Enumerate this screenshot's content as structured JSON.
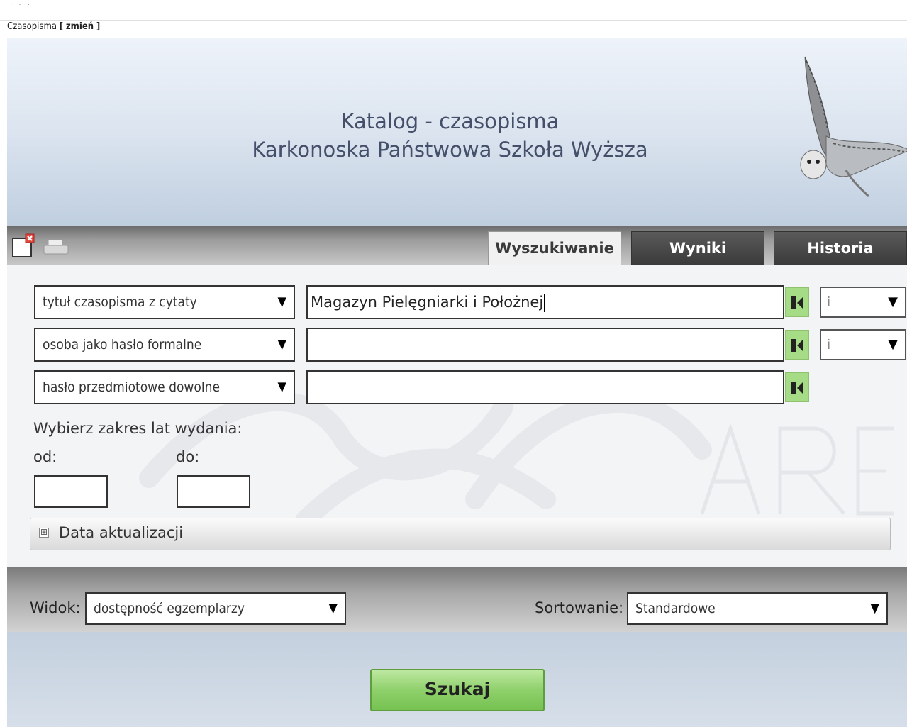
{
  "breadcrumb": {
    "label": "Czasopisma",
    "open": "[",
    "link": "zmień",
    "close": "]"
  },
  "header": {
    "title_line1": "Katalog - czasopisma",
    "title_line2": "Karkonoska Państwowa Szkoła Wyższa"
  },
  "toolbar": {
    "icons": [
      "new-window-icon",
      "printer-icon"
    ]
  },
  "tabs": [
    {
      "label": "Wyszukiwanie",
      "active": true
    },
    {
      "label": "Wyniki",
      "active": false
    },
    {
      "label": "Historia",
      "active": false
    }
  ],
  "search_rows": [
    {
      "field": "tytuł czasopisma z cytaty",
      "value": "Magazyn Pielęgniarki i Położnej",
      "operator": "i"
    },
    {
      "field": "osoba jako hasło formalne",
      "value": "",
      "operator": "i"
    },
    {
      "field": "hasło przedmiotowe dowolne",
      "value": ""
    }
  ],
  "year_range": {
    "label": "Wybierz zakres lat wydania:",
    "from_label": "od:",
    "to_label": "do:",
    "from": "",
    "to": ""
  },
  "accordion": {
    "label": "Data aktualizacji",
    "toggle": "⊞"
  },
  "view": {
    "label": "Widok:",
    "value": "dostępność egzemplarzy"
  },
  "sort": {
    "label": "Sortowanie:",
    "value": "Standardowe"
  },
  "search_button": "Szukaj",
  "colors": {
    "accent_green": "#8fd06b",
    "tab_dark": "#3a3a3a",
    "banner_text": "#44506a"
  }
}
